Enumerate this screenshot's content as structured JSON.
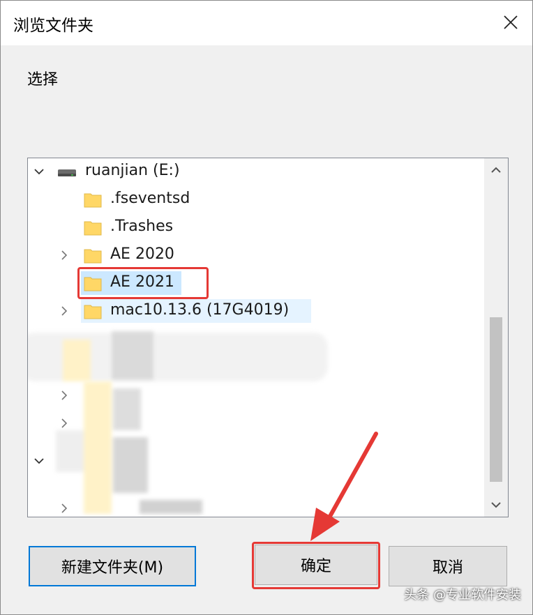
{
  "window": {
    "title": "浏览文件夹",
    "prompt": "选择"
  },
  "tree": {
    "drive_label": "ruanjian (E:)",
    "items": [
      {
        "label": ".fseventsd",
        "expandable": false
      },
      {
        "label": ".Trashes",
        "expandable": false
      },
      {
        "label": "AE 2020",
        "expandable": true
      },
      {
        "label": "AE 2021",
        "expandable": false,
        "selected": true
      },
      {
        "label": "mac10.13.6  (17G4019)",
        "expandable": true
      }
    ]
  },
  "buttons": {
    "new_folder": "新建文件夹(M)",
    "ok": "确定",
    "cancel": "取消"
  },
  "watermark": "头条 @专业软件安装",
  "colors": {
    "selection": "#cce8ff",
    "annotation_red": "#e53935",
    "focus_blue": "#0078d7",
    "folder_yellow": "#ffd766"
  }
}
